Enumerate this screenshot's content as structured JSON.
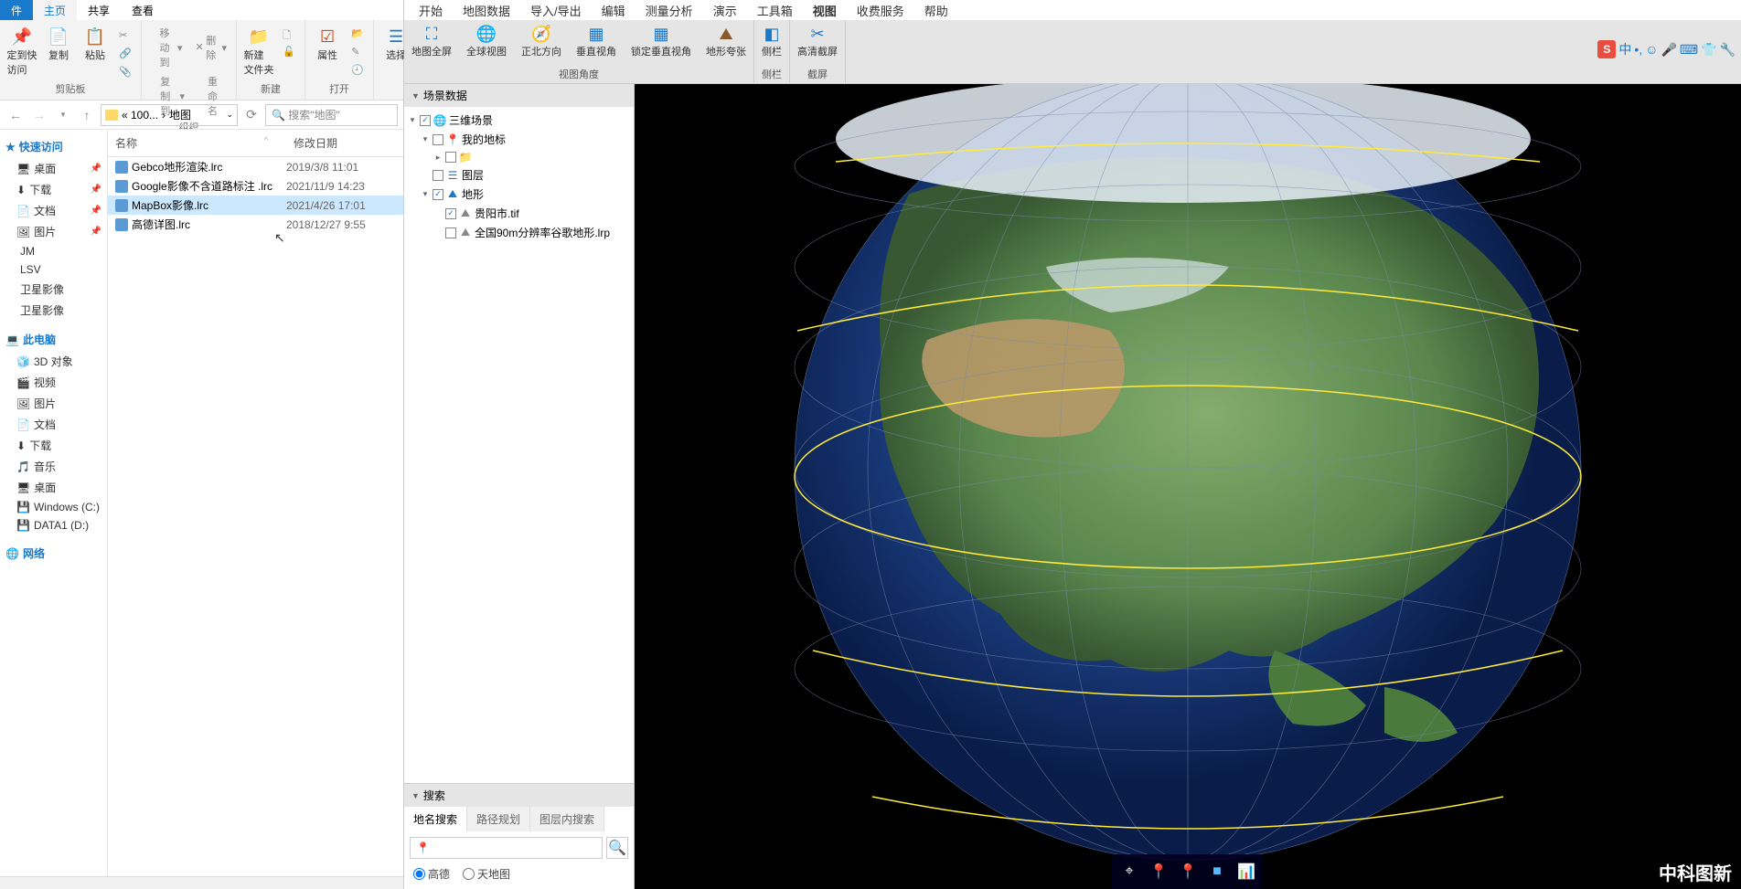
{
  "explorer": {
    "tabs": [
      "件",
      "主页",
      "共享",
      "查看"
    ],
    "ribbon": {
      "clipboard": {
        "pin": "定到快\n访问",
        "copy": "复制",
        "paste": "粘贴",
        "label": "剪贴板"
      },
      "organize": {
        "move": "移动到",
        "copy_to": "复制到",
        "delete": "删除",
        "rename": "重命名",
        "label": "组织"
      },
      "new": {
        "folder": "新建\n文件夹",
        "label": "新建"
      },
      "open": {
        "props": "属性",
        "label": "打开"
      },
      "select": {
        "btn": "选择",
        "label": ""
      }
    },
    "path": {
      "pre": "«  100...",
      "cur": "地图"
    },
    "search_placeholder": "搜索\"地图\"",
    "nav": {
      "quick": "快速访问",
      "quick_items": [
        "桌面",
        "下载",
        "文档",
        "图片",
        "JM",
        "LSV",
        "卫星影像",
        "卫星影像"
      ],
      "this_pc": "此电脑",
      "pc_items": [
        "3D 对象",
        "视频",
        "图片",
        "文档",
        "下载",
        "音乐",
        "桌面",
        "Windows (C:)",
        "DATA1 (D:)"
      ],
      "network": "网络"
    },
    "columns": {
      "name": "名称",
      "date": "修改日期"
    },
    "files": [
      {
        "name": "Gebco地形渲染.lrc",
        "date": "2019/3/8 11:01"
      },
      {
        "name": "Google影像不含道路标注 .lrc",
        "date": "2021/11/9 14:23"
      },
      {
        "name": "MapBox影像.lrc",
        "date": "2021/4/26 17:01"
      },
      {
        "name": "高德详图.lrc",
        "date": "2018/12/27 9:55"
      }
    ]
  },
  "gis": {
    "menu": [
      "开始",
      "地图数据",
      "导入/导出",
      "编辑",
      "测量分析",
      "演示",
      "工具箱",
      "视图",
      "收费服务",
      "帮助"
    ],
    "ribbon": {
      "view_angle": {
        "items": [
          "地图全屏",
          "全球视图",
          "正北方向",
          "垂直视角",
          "锁定垂直视角",
          "地形夸张"
        ],
        "label": "视图角度"
      },
      "sidebar": {
        "item": "侧栏",
        "label": "侧栏"
      },
      "screenshot": {
        "item": "高清截屏",
        "label": "截屏"
      }
    },
    "scene": {
      "title": "场景数据",
      "root": "三维场景",
      "landmarks": "我的地标",
      "layers": "图层",
      "terrain": "地形",
      "terrain_items": [
        "贵阳市.tif",
        "全国90m分辨率谷歌地形.lrp"
      ]
    },
    "search": {
      "title": "搜索",
      "tabs": [
        "地名搜索",
        "路径规划",
        "图层内搜索"
      ],
      "radio": [
        "高德",
        "天地图"
      ],
      "icon": "📍"
    },
    "watermark": "中科图新",
    "toolbar_icons": [
      "⌖",
      "📍",
      "📍",
      "■",
      "📊"
    ]
  },
  "ime": {
    "s": "S",
    "lang": "中"
  }
}
